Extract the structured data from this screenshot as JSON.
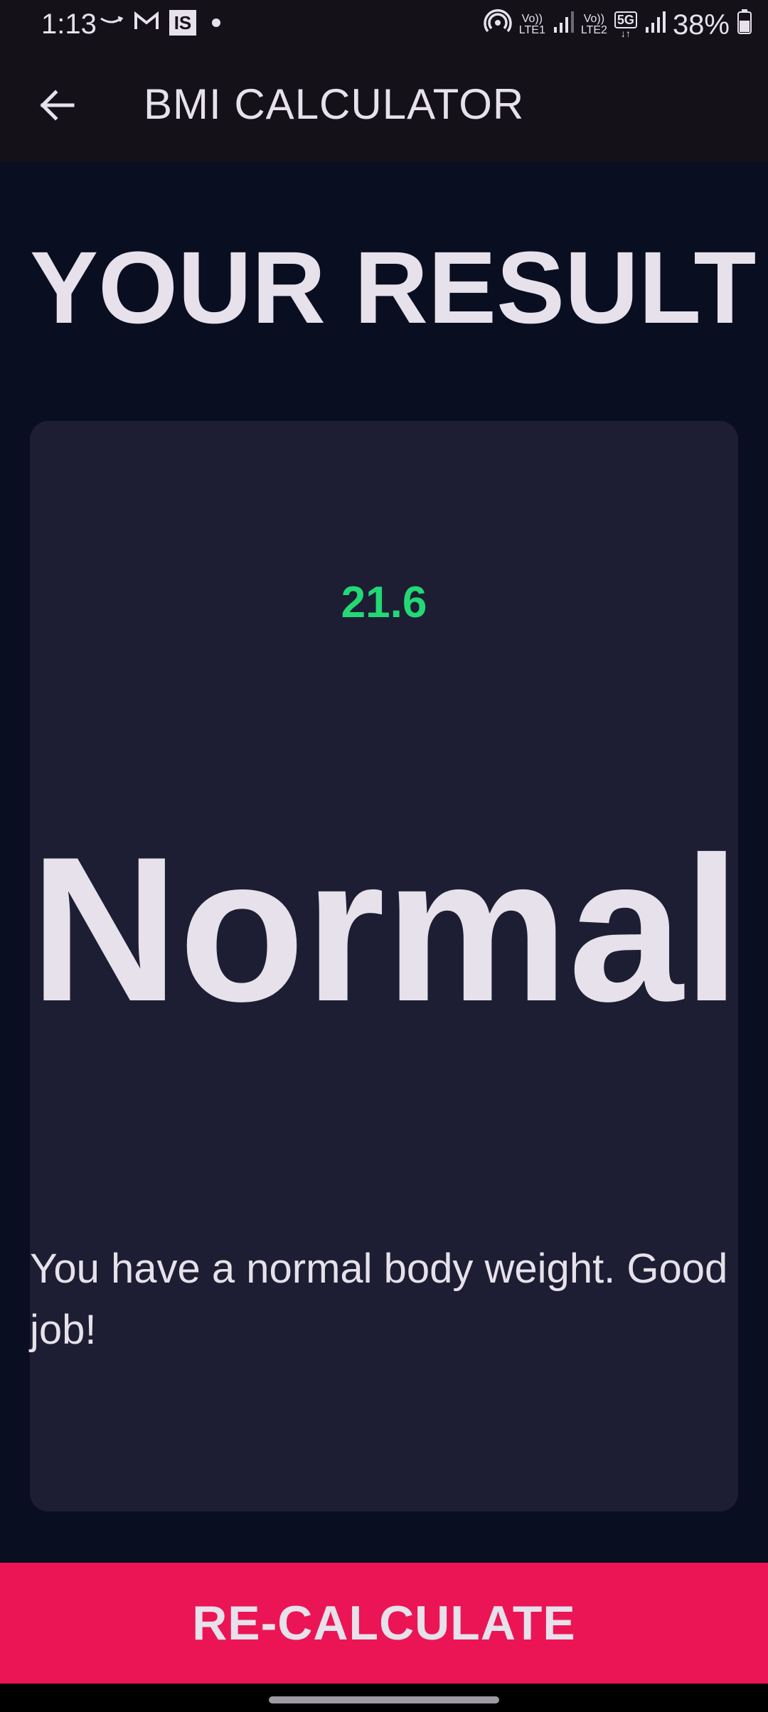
{
  "status_bar": {
    "time": "1:13",
    "left_icons": [
      "amazon-icon",
      "gmail-icon",
      "is-app-icon",
      "notification-dot-icon"
    ],
    "is_badge": "IS",
    "sim1_label_top": "Vo))",
    "sim1_label_bottom": "LTE1",
    "sim2_label_top": "Vo))",
    "sim2_label_bottom": "LTE2",
    "network_badge": "5G",
    "battery_percent": "38%"
  },
  "app_bar": {
    "title": "BMI CALCULATOR",
    "back_icon": "arrow-left-icon"
  },
  "page": {
    "title": "YOUR RESULT"
  },
  "result": {
    "bmi_value": "21.6",
    "category": "Normal",
    "message": "You have a normal body weight. Good job!"
  },
  "actions": {
    "recalculate_label": "RE-CALCULATE"
  },
  "colors": {
    "background": "#0a0e21",
    "card": "#1d1e33",
    "accent_green": "#24d876",
    "accent_pink": "#eb1555",
    "text": "#e6e1ea"
  }
}
